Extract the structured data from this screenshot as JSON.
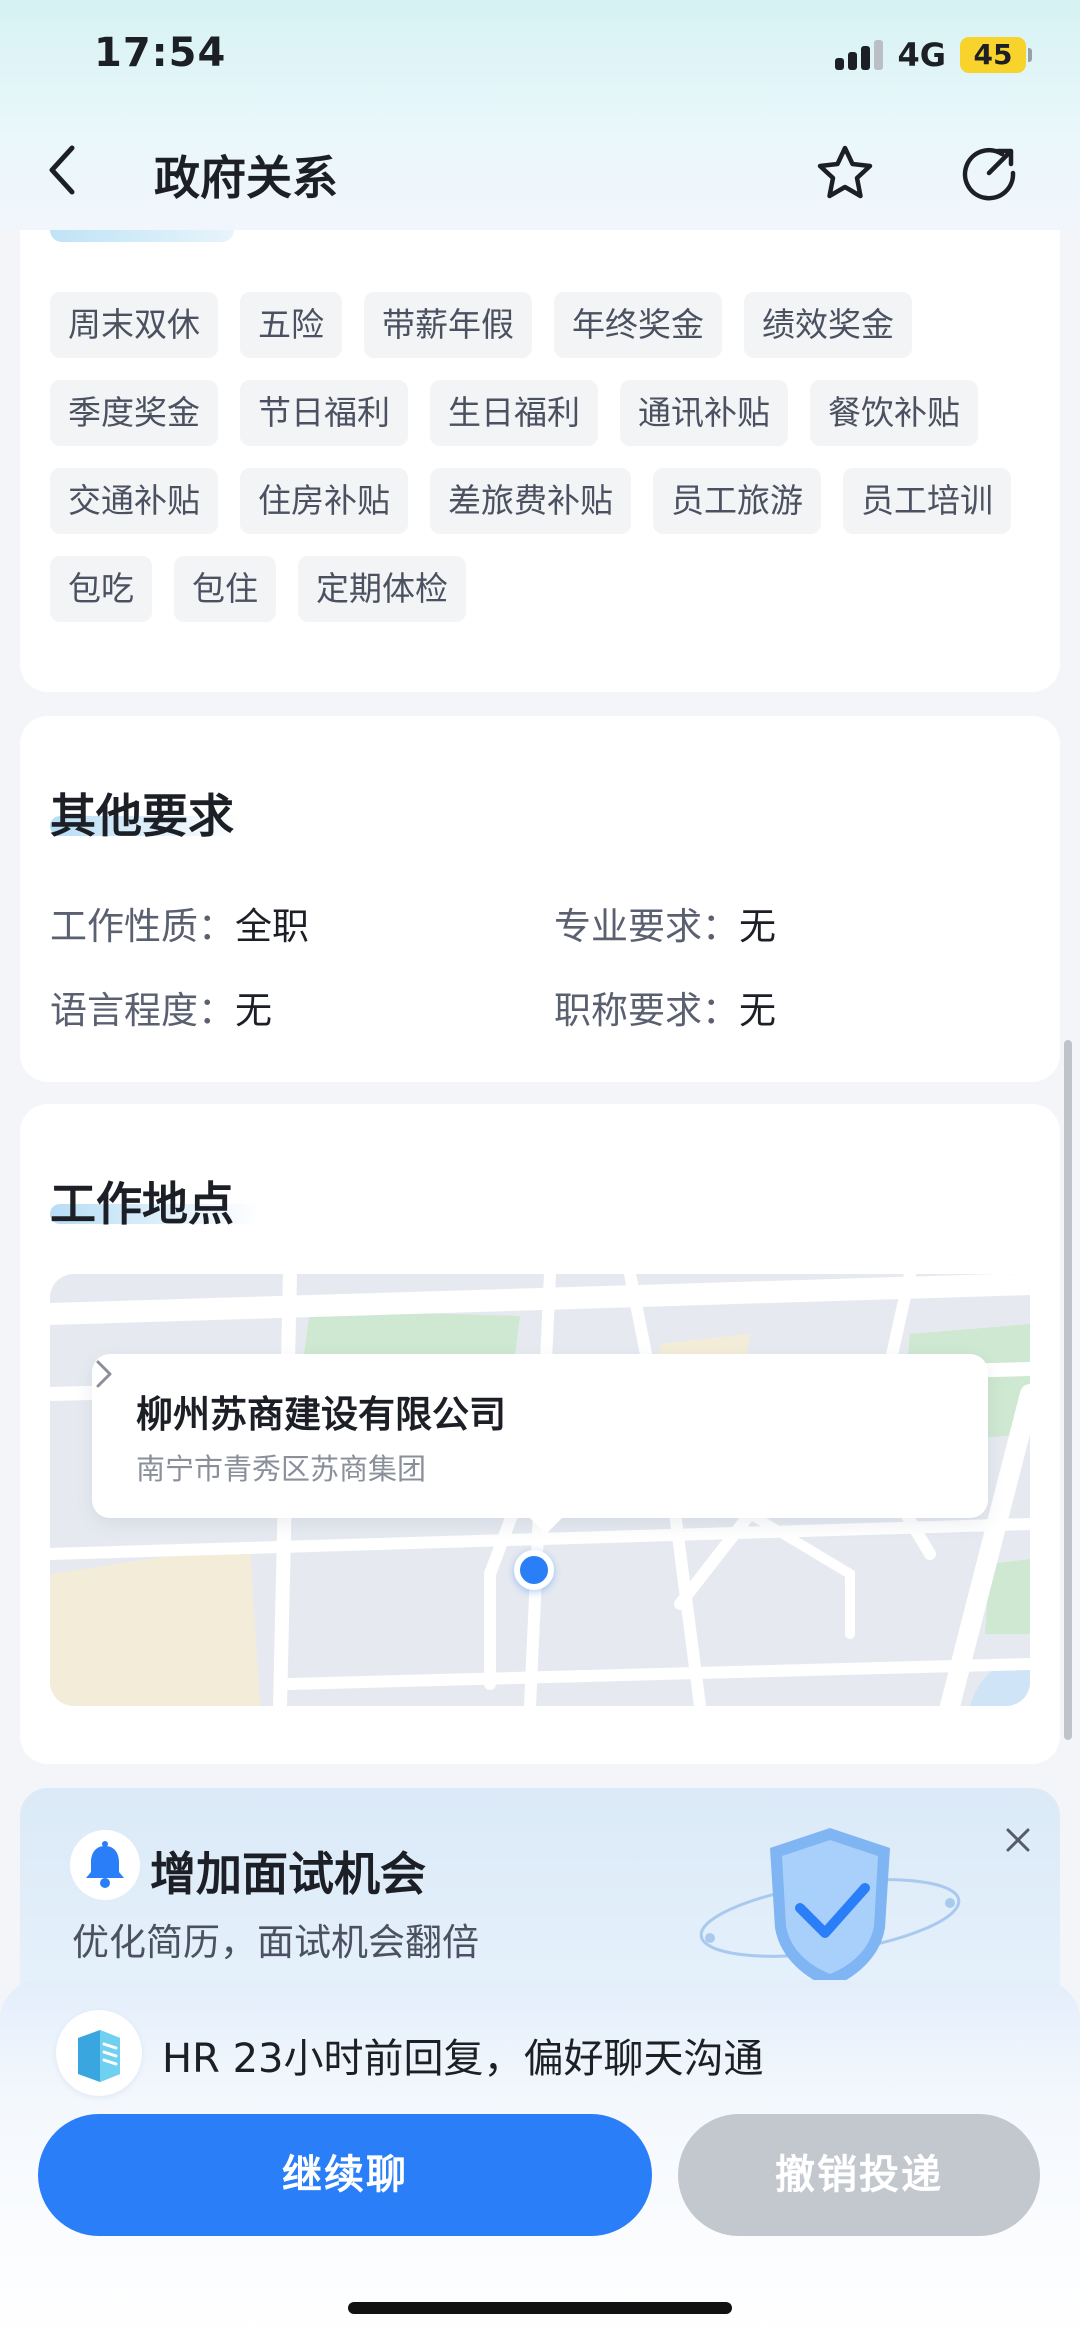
{
  "status_bar": {
    "time": "17:54",
    "network": "4G",
    "battery": "45"
  },
  "header": {
    "title": "政府关系"
  },
  "benefits": {
    "tags": [
      "周末双休",
      "五险",
      "带薪年假",
      "年终奖金",
      "绩效奖金",
      "季度奖金",
      "节日福利",
      "生日福利",
      "通讯补贴",
      "餐饮补贴",
      "交通补贴",
      "住房补贴",
      "差旅费补贴",
      "员工旅游",
      "员工培训",
      "包吃",
      "包住",
      "定期体检"
    ]
  },
  "other_requirements": {
    "title": "其他要求",
    "items": [
      {
        "key": "工作性质：",
        "value": "全职"
      },
      {
        "key": "专业要求：",
        "value": "无"
      },
      {
        "key": "语言程度：",
        "value": "无"
      },
      {
        "key": "职称要求：",
        "value": "无"
      }
    ]
  },
  "location": {
    "title": "工作地点",
    "company": "柳州苏商建设有限公司",
    "address": "南宁市青秀区苏商集团"
  },
  "promo": {
    "title": "增加面试机会",
    "subtitle": "优化简历，面试机会翻倍"
  },
  "bottom": {
    "hr_status": "HR 23小时前回复，偏好聊天沟通",
    "primary_button": "继续聊",
    "secondary_button": "撤销投递"
  },
  "colors": {
    "accent": "#2a7ef7",
    "disabled": "#c3c8cf",
    "battery": "#f7d32b"
  }
}
